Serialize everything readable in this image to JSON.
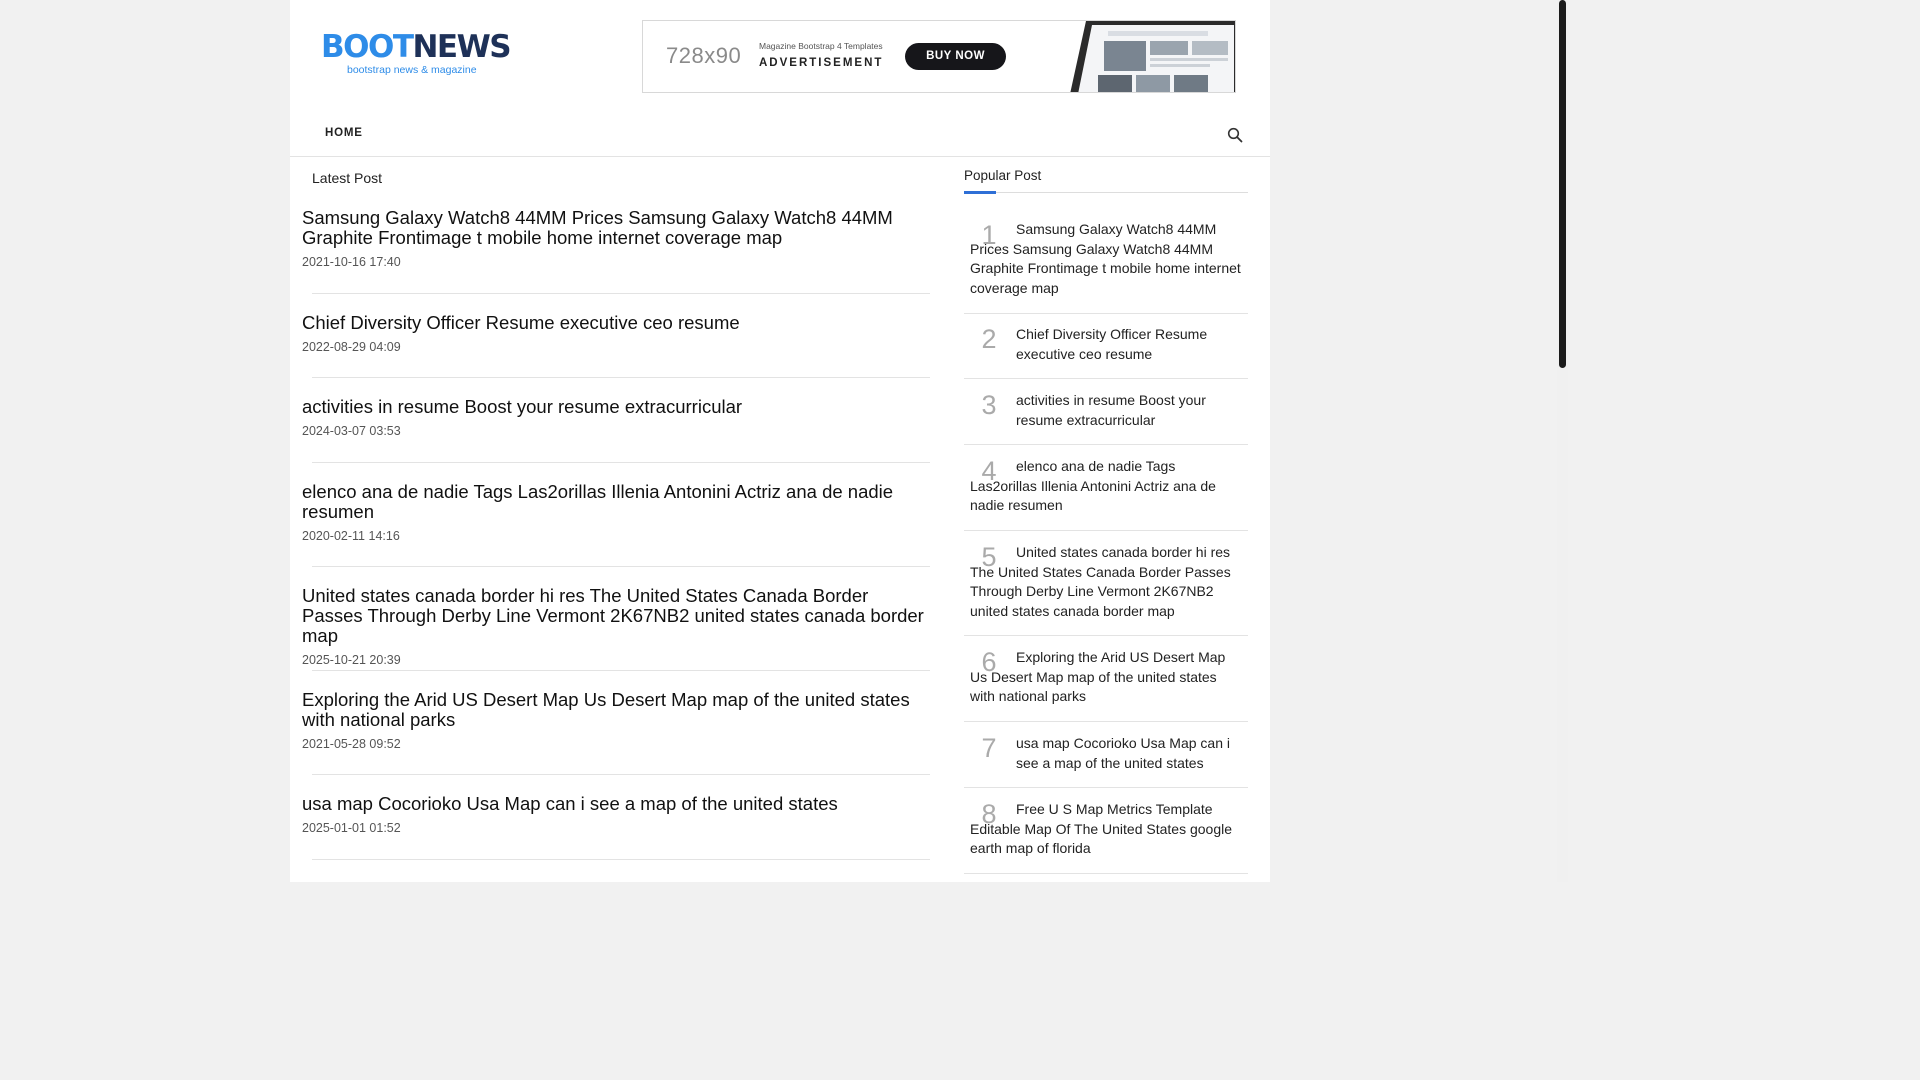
{
  "logo": {
    "part1": "BOOT",
    "part2": "NEWS",
    "tagline": "bootstrap news & magazine"
  },
  "ad": {
    "size": "728x90",
    "template": "Magazine Bootstrap 4 Templates",
    "label": "ADVERTISEMENT",
    "cta": "BUY NOW"
  },
  "nav": {
    "home": "HOME",
    "search_icon": "search-icon"
  },
  "latest": {
    "title": "Latest Post",
    "posts": [
      {
        "title": "Samsung Galaxy Watch8 44MM Prices Samsung Galaxy Watch8 44MM Graphite Frontimage t mobile home internet coverage map",
        "date": "2021-10-16 17:40"
      },
      {
        "title": "Chief Diversity Officer Resume executive ceo resume",
        "date": "2022-08-29 04:09"
      },
      {
        "title": "activities in resume Boost your resume extracurricular",
        "date": "2024-03-07 03:53"
      },
      {
        "title": "elenco ana de nadie Tags Las2orillas Illenia Antonini Actriz ana de nadie resumen",
        "date": "2020-02-11 14:16"
      },
      {
        "title": "United states canada border hi res The United States Canada Border Passes Through Derby Line Vermont 2K67NB2 united states canada border map",
        "date": "2025-10-21 20:39"
      },
      {
        "title": "Exploring the Arid US Desert Map Us Desert Map map of the united states with national parks",
        "date": "2021-05-28 09:52"
      },
      {
        "title": "usa map Cocorioko Usa Map can i see a map of the united states",
        "date": "2025-01-01 01:52"
      }
    ]
  },
  "popular": {
    "title": "Popular Post",
    "items": [
      {
        "num": "1",
        "title": "Samsung Galaxy Watch8 44MM Prices Samsung Galaxy Watch8 44MM Graphite Frontimage t mobile home internet coverage map"
      },
      {
        "num": "2",
        "title": "Chief Diversity Officer Resume executive ceo resume"
      },
      {
        "num": "3",
        "title": "activities in resume Boost your resume extracurricular"
      },
      {
        "num": "4",
        "title": "elenco ana de nadie Tags Las2orillas Illenia Antonini Actriz ana de nadie resumen"
      },
      {
        "num": "5",
        "title": "United states canada border hi res The United States Canada Border Passes Through Derby Line Vermont 2K67NB2 united states canada border map"
      },
      {
        "num": "6",
        "title": "Exploring the Arid US Desert Map Us Desert Map map of the united states with national parks"
      },
      {
        "num": "7",
        "title": "usa map Cocorioko Usa Map can i see a map of the united states"
      },
      {
        "num": "8",
        "title": "Free U S Map Metrics Template Editable Map Of The United States google earth map of florida"
      }
    ]
  },
  "colors": {
    "accent": "#2e8ce8",
    "logo_dark": "#1e3158",
    "popular_underline": "#2e6fd6"
  }
}
